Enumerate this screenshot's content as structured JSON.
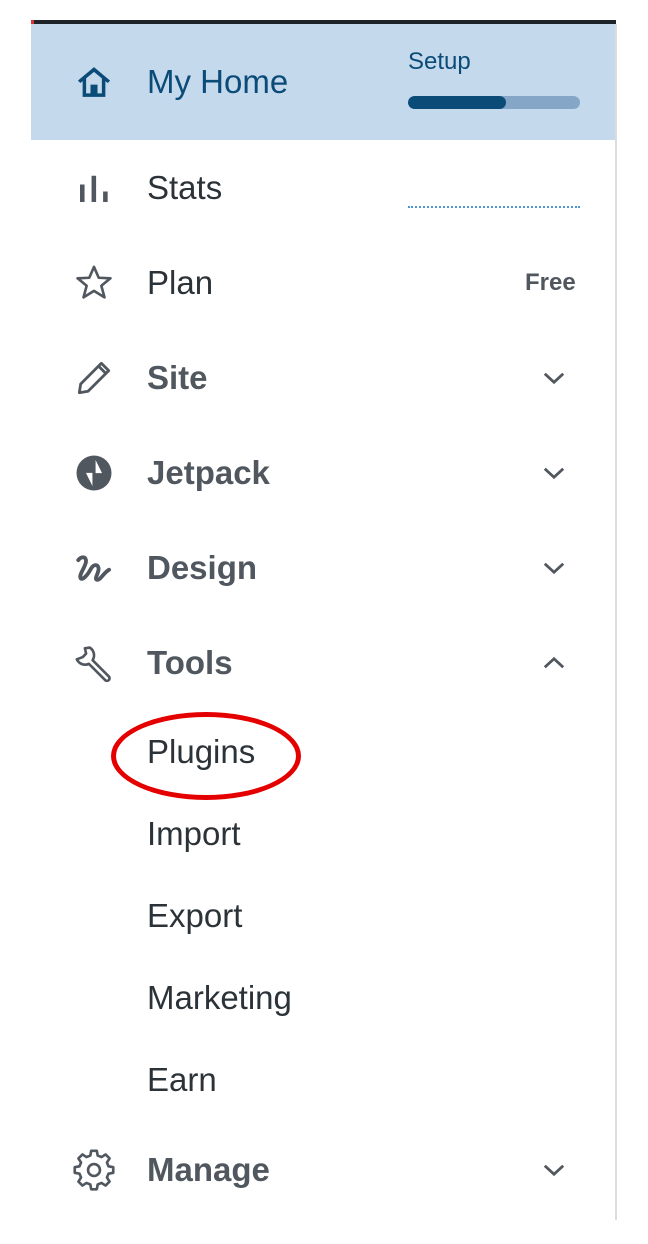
{
  "nav": {
    "home": {
      "label": "My Home",
      "icon": "home-icon",
      "setup_label": "Setup",
      "setup_progress": 0.57
    },
    "stats": {
      "label": "Stats",
      "icon": "stats-bars-icon"
    },
    "plan": {
      "label": "Plan",
      "icon": "star-icon",
      "badge": "Free"
    },
    "site": {
      "label": "Site",
      "icon": "pencil-icon"
    },
    "jetpack": {
      "label": "Jetpack",
      "icon": "jetpack-icon"
    },
    "design": {
      "label": "Design",
      "icon": "design-squiggle-icon"
    },
    "tools": {
      "label": "Tools",
      "icon": "wrench-icon",
      "expanded": true,
      "children": [
        "Plugins",
        "Import",
        "Export",
        "Marketing",
        "Earn"
      ]
    },
    "manage": {
      "label": "Manage",
      "icon": "gear-icon"
    }
  },
  "colors": {
    "accent": "#0a4b78",
    "selected_bg": "#c5d9ed",
    "annotation": "#e50000"
  }
}
